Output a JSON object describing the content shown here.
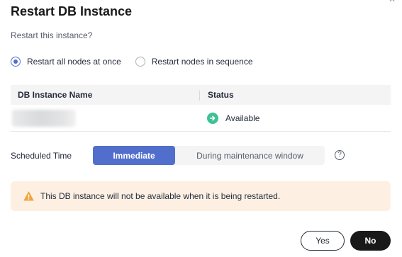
{
  "dialog": {
    "title": "Restart DB Instance",
    "subtitle": "Restart this instance?",
    "close_glyph": "×"
  },
  "restart_mode": {
    "options": [
      {
        "label": "Restart all nodes at once",
        "selected": true
      },
      {
        "label": "Restart nodes in sequence",
        "selected": false
      }
    ]
  },
  "table": {
    "columns": [
      "DB Instance Name",
      "Status"
    ],
    "rows": [
      {
        "name": "",
        "status": "Available",
        "status_icon": "arrow-right-circle-icon"
      }
    ]
  },
  "schedule": {
    "label": "Scheduled Time",
    "options": [
      "Immediate",
      "During maintenance window"
    ],
    "selected": "Immediate",
    "help_glyph": "?"
  },
  "alert": {
    "icon": "warning-triangle-icon",
    "message": "This DB instance will not be available when it is being restarted."
  },
  "footer": {
    "yes_label": "Yes",
    "no_label": "No"
  },
  "colors": {
    "primary": "#526ecc",
    "success": "#3fc194",
    "warning": "#f0a43a",
    "alert_bg": "#fdf0e3",
    "dark_button": "#191919"
  }
}
